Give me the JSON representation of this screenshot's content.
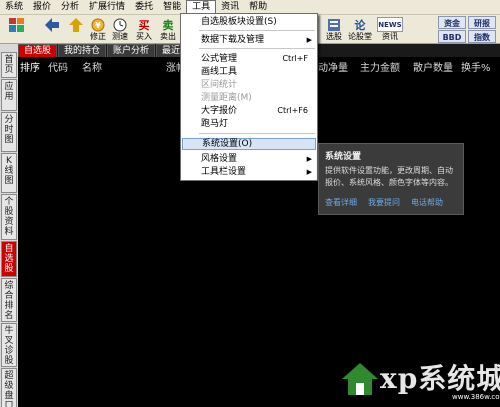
{
  "menubar": [
    "系统",
    "报价",
    "分析",
    "扩展行情",
    "委托",
    "智能",
    "工具",
    "资讯",
    "帮助"
  ],
  "toolbar": {
    "buttons": [
      {
        "label": "",
        "icon": "grid-icon",
        "color": "#c0392b"
      },
      {
        "label": "",
        "icon": "back-arrow-icon",
        "color": "#2c5aa0"
      },
      {
        "label": "",
        "icon": "up-arrow-icon",
        "color": "#c79a00"
      },
      {
        "label": "修正",
        "icon": "refresh-icon",
        "color": "#d38b00"
      },
      {
        "label": "测速",
        "icon": "clock-icon",
        "color": "#5a5a5a"
      },
      {
        "label": "买入",
        "icon": "buy-icon",
        "color": "#c00000"
      },
      {
        "label": "卖出",
        "icon": "sell-icon",
        "color": "#1a7f1a"
      }
    ],
    "right_buttons": [
      {
        "label": "选股",
        "icon": "filter-icon"
      },
      {
        "label": "论股堂",
        "icon": "forum-icon"
      },
      {
        "label": "资讯",
        "icon": "news-icon",
        "badge": "NEWS"
      }
    ],
    "badges": [
      "资金",
      "研报",
      "BBD",
      "指数"
    ]
  },
  "tabs": [
    "自选股",
    "我的持仓",
    "账户分析",
    "最近浏"
  ],
  "header": {
    "cols": [
      "排序",
      "代码",
      "名称",
      "涨幅%"
    ],
    "right_cols": [
      "动净量",
      "主力金额",
      "散户数量",
      "换手%"
    ]
  },
  "sidebar": [
    "首页",
    "应用",
    "分时图",
    "K线图",
    "个股资料",
    "自选股",
    "综合排名",
    "牛叉诊股",
    "超级盘口"
  ],
  "dropdown": {
    "items": [
      {
        "label": "自选股板块设置(S)",
        "shortcut": "",
        "submenu": false,
        "disabled": false
      },
      {
        "label": "数据下载及管理",
        "shortcut": "",
        "submenu": true,
        "disabled": false
      },
      {
        "label": "公式管理",
        "shortcut": "Ctrl+F",
        "submenu": false,
        "disabled": false
      },
      {
        "label": "画线工具",
        "shortcut": "",
        "submenu": false,
        "disabled": false
      },
      {
        "label": "区间统计",
        "shortcut": "",
        "submenu": false,
        "disabled": true
      },
      {
        "label": "测量距离(M)",
        "shortcut": "",
        "submenu": false,
        "disabled": true
      },
      {
        "label": "大字报价",
        "shortcut": "Ctrl+F6",
        "submenu": false,
        "disabled": false
      },
      {
        "label": "跑马灯",
        "shortcut": "",
        "submenu": false,
        "disabled": false
      },
      {
        "label": "系统设置(O)",
        "shortcut": "",
        "submenu": false,
        "disabled": false,
        "highlighted": true
      },
      {
        "label": "风格设置",
        "shortcut": "",
        "submenu": true,
        "disabled": false
      },
      {
        "label": "工具栏设置",
        "shortcut": "",
        "submenu": true,
        "disabled": false
      }
    ]
  },
  "tooltip": {
    "title": "系统设置",
    "body": "提供软件设置功能，更改周期、自动报价、系统风格、颜色字体等内容。",
    "links": [
      "查看详细",
      "我要提问",
      "电话帮助"
    ]
  },
  "watermark": {
    "text": "xp系统城",
    "url": "www.386w.com"
  },
  "colors": {
    "accent_red": "#cc0000",
    "menu_bg": "#ece9d8",
    "highlight": "#d7e4f6",
    "tooltip_bg": "#3b3b3b",
    "link": "#6fa8e8"
  }
}
